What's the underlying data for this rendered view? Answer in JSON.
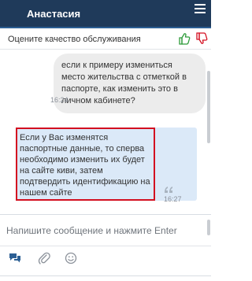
{
  "header": {
    "title": "Анастасия",
    "menu_icon": "hamburger-icon",
    "background_color": "#1f3a5a"
  },
  "rating": {
    "label": "Оцените качество обслуживания",
    "thumb_up_icon": "thumbs-up-icon",
    "thumb_down_icon": "thumbs-down-icon",
    "thumb_up_color": "#2e9b3a",
    "thumb_down_color": "#d30f20"
  },
  "messages": [
    {
      "direction": "incoming",
      "text": "если к примеру измениться место жительства с отметкой в паспорте, как изменить это в личном кабинете?",
      "time": "16:24",
      "bubble_color": "#ececec"
    },
    {
      "direction": "outgoing",
      "text": "Если у Вас изменятся паспортные данные, то сперва необходимо изменить их будет на сайте киви, затем подтвердить идентификацию на нашем сайте",
      "time": "16:27",
      "bubble_color": "#dbe9f8",
      "highlight_color": "#d30f20",
      "status_icon": "quote-icon"
    }
  ],
  "input": {
    "placeholder": "Напишите сообщение и нажмите Enter",
    "value": ""
  },
  "toolbar": {
    "chat_icon": "chat-bubbles-icon",
    "attach_icon": "paperclip-icon",
    "emoji_icon": "smiley-icon",
    "active_color": "#2c5f94"
  }
}
